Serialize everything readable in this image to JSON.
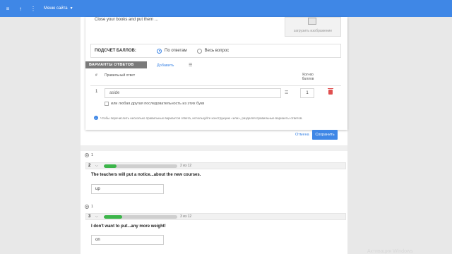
{
  "topbar": {
    "menu_label": "Меню сайта",
    "icons": [
      "hamburger-icon",
      "up-arrow-icon",
      "more-vertical-icon"
    ],
    "bg_color": "#3f87e6"
  },
  "editor": {
    "question_text": "Close your books and put them ...",
    "image_button_label": "загрузить изображение",
    "scoring": {
      "label": "ПОДСЧЕТ БАЛЛОВ:",
      "options": [
        "По ответам",
        "Весь вопрос"
      ],
      "selected": "По ответам"
    },
    "variants": {
      "header": "ВАРИАНТЫ ОТВЕТОВ",
      "add_label": "Добавить",
      "col_num": "#",
      "col_answer": "Правильный ответ",
      "col_score": "Кол-во баллов",
      "rows": [
        {
          "num": "1",
          "answer": "aside",
          "score": "1"
        }
      ],
      "checkbox_label": "или любая другая последовательность из этих букв"
    },
    "hint": "Чтобы перечислить несколько правильных вариантов ответа, используйте конструкцию «или», разделяя правильные варианты ответов.",
    "cancel_label": "Отмена",
    "save_label": "Сохранить"
  },
  "questions": [
    {
      "meta": "1",
      "number": "2",
      "progress": 0.17,
      "count": "2 из 12",
      "sentence": "The teachers will put a notice...about the new courses.",
      "answer": "up"
    },
    {
      "meta": "1",
      "number": "3",
      "progress": 0.25,
      "count": "3 из 12",
      "sentence": "I don't want to put...any more weight!",
      "answer": "on"
    }
  ],
  "watermark": "Активация Windows"
}
